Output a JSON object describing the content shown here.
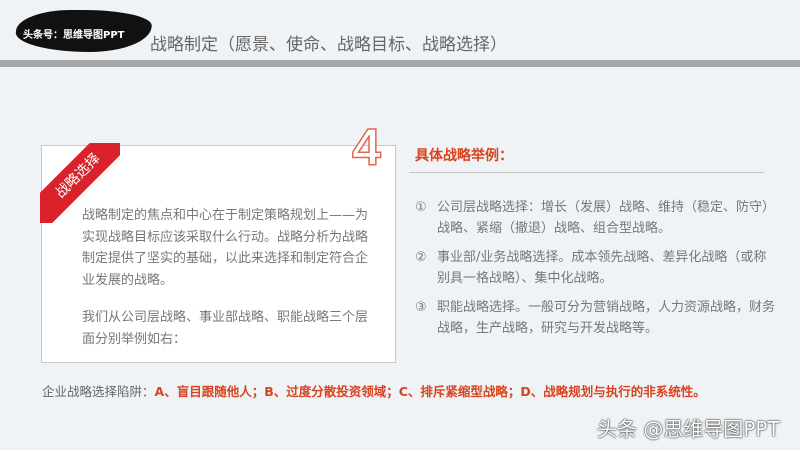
{
  "header": {
    "logo_text": "头条号：思维导图PPT",
    "title": "战略制定（愿景、使命、战略目标、战略选择）"
  },
  "card": {
    "ribbon": "战略选择",
    "number": "4",
    "paragraphs": [
      "战略制定的焦点和中心在于制定策略规划上——为实现战略目标应该采取什么行动。战略分析为战略制定提供了坚实的基础，以此来选择和制定符合企业发展的战略。",
      "我们从公司层战略、事业部战略、职能战略三个层面分别举例如右："
    ]
  },
  "examples": {
    "heading": "具体战略举例：",
    "items": [
      {
        "num": "①",
        "text": "公司层战略选择：增长（发展）战略、维持（稳定、防守）战略、紧缩（撤退）战略、组合型战略。"
      },
      {
        "num": "②",
        "text": "事业部/业务战略选择。成本领先战略、差异化战略（或称别具一格战略）、集中化战略。"
      },
      {
        "num": "③",
        "text": "职能战略选择。一般可分为营销战略，人力资源战略，财务战略，生产战略，研究与开发战略等。"
      }
    ]
  },
  "footer": {
    "label": "企业战略选择陷阱：",
    "traps": "A、盲目跟随他人；B、过度分散投资领域；C、排斥紧缩型战略；D、战略规划与执行的非系统性。"
  },
  "watermark": "头条 @思维导图PPT"
}
